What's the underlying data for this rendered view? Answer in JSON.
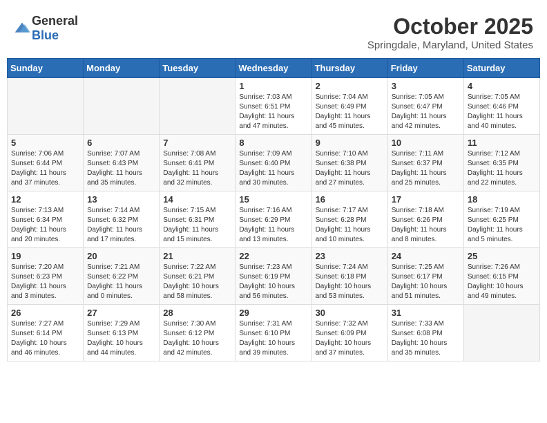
{
  "header": {
    "logo_general": "General",
    "logo_blue": "Blue",
    "month_title": "October 2025",
    "location": "Springdale, Maryland, United States"
  },
  "weekdays": [
    "Sunday",
    "Monday",
    "Tuesday",
    "Wednesday",
    "Thursday",
    "Friday",
    "Saturday"
  ],
  "weeks": [
    [
      {
        "day": "",
        "sunrise": "",
        "sunset": "",
        "daylight": ""
      },
      {
        "day": "",
        "sunrise": "",
        "sunset": "",
        "daylight": ""
      },
      {
        "day": "",
        "sunrise": "",
        "sunset": "",
        "daylight": ""
      },
      {
        "day": "1",
        "sunrise": "Sunrise: 7:03 AM",
        "sunset": "Sunset: 6:51 PM",
        "daylight": "Daylight: 11 hours and 47 minutes."
      },
      {
        "day": "2",
        "sunrise": "Sunrise: 7:04 AM",
        "sunset": "Sunset: 6:49 PM",
        "daylight": "Daylight: 11 hours and 45 minutes."
      },
      {
        "day": "3",
        "sunrise": "Sunrise: 7:05 AM",
        "sunset": "Sunset: 6:47 PM",
        "daylight": "Daylight: 11 hours and 42 minutes."
      },
      {
        "day": "4",
        "sunrise": "Sunrise: 7:05 AM",
        "sunset": "Sunset: 6:46 PM",
        "daylight": "Daylight: 11 hours and 40 minutes."
      }
    ],
    [
      {
        "day": "5",
        "sunrise": "Sunrise: 7:06 AM",
        "sunset": "Sunset: 6:44 PM",
        "daylight": "Daylight: 11 hours and 37 minutes."
      },
      {
        "day": "6",
        "sunrise": "Sunrise: 7:07 AM",
        "sunset": "Sunset: 6:43 PM",
        "daylight": "Daylight: 11 hours and 35 minutes."
      },
      {
        "day": "7",
        "sunrise": "Sunrise: 7:08 AM",
        "sunset": "Sunset: 6:41 PM",
        "daylight": "Daylight: 11 hours and 32 minutes."
      },
      {
        "day": "8",
        "sunrise": "Sunrise: 7:09 AM",
        "sunset": "Sunset: 6:40 PM",
        "daylight": "Daylight: 11 hours and 30 minutes."
      },
      {
        "day": "9",
        "sunrise": "Sunrise: 7:10 AM",
        "sunset": "Sunset: 6:38 PM",
        "daylight": "Daylight: 11 hours and 27 minutes."
      },
      {
        "day": "10",
        "sunrise": "Sunrise: 7:11 AM",
        "sunset": "Sunset: 6:37 PM",
        "daylight": "Daylight: 11 hours and 25 minutes."
      },
      {
        "day": "11",
        "sunrise": "Sunrise: 7:12 AM",
        "sunset": "Sunset: 6:35 PM",
        "daylight": "Daylight: 11 hours and 22 minutes."
      }
    ],
    [
      {
        "day": "12",
        "sunrise": "Sunrise: 7:13 AM",
        "sunset": "Sunset: 6:34 PM",
        "daylight": "Daylight: 11 hours and 20 minutes."
      },
      {
        "day": "13",
        "sunrise": "Sunrise: 7:14 AM",
        "sunset": "Sunset: 6:32 PM",
        "daylight": "Daylight: 11 hours and 17 minutes."
      },
      {
        "day": "14",
        "sunrise": "Sunrise: 7:15 AM",
        "sunset": "Sunset: 6:31 PM",
        "daylight": "Daylight: 11 hours and 15 minutes."
      },
      {
        "day": "15",
        "sunrise": "Sunrise: 7:16 AM",
        "sunset": "Sunset: 6:29 PM",
        "daylight": "Daylight: 11 hours and 13 minutes."
      },
      {
        "day": "16",
        "sunrise": "Sunrise: 7:17 AM",
        "sunset": "Sunset: 6:28 PM",
        "daylight": "Daylight: 11 hours and 10 minutes."
      },
      {
        "day": "17",
        "sunrise": "Sunrise: 7:18 AM",
        "sunset": "Sunset: 6:26 PM",
        "daylight": "Daylight: 11 hours and 8 minutes."
      },
      {
        "day": "18",
        "sunrise": "Sunrise: 7:19 AM",
        "sunset": "Sunset: 6:25 PM",
        "daylight": "Daylight: 11 hours and 5 minutes."
      }
    ],
    [
      {
        "day": "19",
        "sunrise": "Sunrise: 7:20 AM",
        "sunset": "Sunset: 6:23 PM",
        "daylight": "Daylight: 11 hours and 3 minutes."
      },
      {
        "day": "20",
        "sunrise": "Sunrise: 7:21 AM",
        "sunset": "Sunset: 6:22 PM",
        "daylight": "Daylight: 11 hours and 0 minutes."
      },
      {
        "day": "21",
        "sunrise": "Sunrise: 7:22 AM",
        "sunset": "Sunset: 6:21 PM",
        "daylight": "Daylight: 10 hours and 58 minutes."
      },
      {
        "day": "22",
        "sunrise": "Sunrise: 7:23 AM",
        "sunset": "Sunset: 6:19 PM",
        "daylight": "Daylight: 10 hours and 56 minutes."
      },
      {
        "day": "23",
        "sunrise": "Sunrise: 7:24 AM",
        "sunset": "Sunset: 6:18 PM",
        "daylight": "Daylight: 10 hours and 53 minutes."
      },
      {
        "day": "24",
        "sunrise": "Sunrise: 7:25 AM",
        "sunset": "Sunset: 6:17 PM",
        "daylight": "Daylight: 10 hours and 51 minutes."
      },
      {
        "day": "25",
        "sunrise": "Sunrise: 7:26 AM",
        "sunset": "Sunset: 6:15 PM",
        "daylight": "Daylight: 10 hours and 49 minutes."
      }
    ],
    [
      {
        "day": "26",
        "sunrise": "Sunrise: 7:27 AM",
        "sunset": "Sunset: 6:14 PM",
        "daylight": "Daylight: 10 hours and 46 minutes."
      },
      {
        "day": "27",
        "sunrise": "Sunrise: 7:29 AM",
        "sunset": "Sunset: 6:13 PM",
        "daylight": "Daylight: 10 hours and 44 minutes."
      },
      {
        "day": "28",
        "sunrise": "Sunrise: 7:30 AM",
        "sunset": "Sunset: 6:12 PM",
        "daylight": "Daylight: 10 hours and 42 minutes."
      },
      {
        "day": "29",
        "sunrise": "Sunrise: 7:31 AM",
        "sunset": "Sunset: 6:10 PM",
        "daylight": "Daylight: 10 hours and 39 minutes."
      },
      {
        "day": "30",
        "sunrise": "Sunrise: 7:32 AM",
        "sunset": "Sunset: 6:09 PM",
        "daylight": "Daylight: 10 hours and 37 minutes."
      },
      {
        "day": "31",
        "sunrise": "Sunrise: 7:33 AM",
        "sunset": "Sunset: 6:08 PM",
        "daylight": "Daylight: 10 hours and 35 minutes."
      },
      {
        "day": "",
        "sunrise": "",
        "sunset": "",
        "daylight": ""
      }
    ]
  ]
}
